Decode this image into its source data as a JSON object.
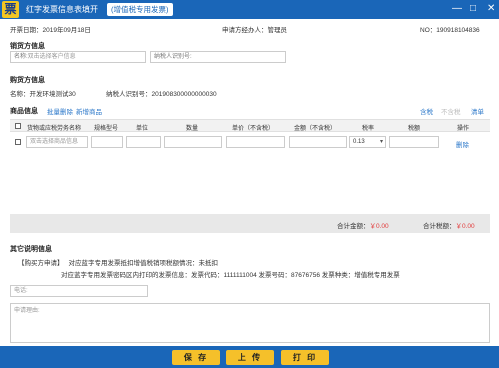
{
  "window": {
    "logo_char": "票",
    "title": "红字发票信息表填开",
    "badge": "(增值税专用发票)",
    "min_glyph": "—",
    "max_glyph": "□",
    "close_glyph": "✕"
  },
  "header": {
    "date_label": "开票日期：",
    "date_value": "2019年09月18日",
    "applicant_label": "申请方经办人：",
    "applicant_value": "管理员",
    "no_label": "NO：",
    "no_value": "190918104836"
  },
  "seller": {
    "title": "销货方信息",
    "name_label": "名称:",
    "name_placeholder": "双击选择客户信息",
    "taxid_label": "纳税人识别号:"
  },
  "buyer": {
    "title": "购货方信息",
    "name_label": "名称：",
    "name_value": "开发环境测试30",
    "taxid_label": "纳税人识别号：",
    "taxid_value": "201908300000000030"
  },
  "goods": {
    "title": "商品信息",
    "batch_delete": "批量删除",
    "add_goods": "新增商品",
    "tax_included": "含税",
    "tax_excluded": "不含税",
    "clear_list": "清单"
  },
  "table": {
    "columns": [
      "货物或应税劳务名称",
      "规格型号",
      "单位",
      "数量",
      "单价（不含税）",
      "金额（不含税）",
      "税率",
      "税额",
      "操作"
    ],
    "row": {
      "name_placeholder": "双击选择商品信息",
      "tax_rate": "0.13",
      "action": "删除"
    }
  },
  "totals": {
    "amount_label": "合计金额：",
    "amount_value": "￥0.00",
    "tax_label": "合计税额：",
    "tax_value": "￥0.00"
  },
  "other": {
    "title": "其它说明信息",
    "tag": "【购买方申请】",
    "line1": "对应蓝字专用发票抵扣增值税销项税额情况：",
    "line1_value": "未抵扣",
    "line2": "对应蓝字专用发票密码区内打印的发票信息：发票代码：1111111004 发票号码：87676756 发票种类：增值税专用发票",
    "phone_placeholder": "电话:",
    "reason_placeholder": "申请理由:"
  },
  "buttons": {
    "save": "保 存",
    "upload": "上 传",
    "print": "打 印"
  },
  "colors": {
    "titlebar": "#1a66b8",
    "button": "#f5c02a",
    "accent_link": "#2a77c9",
    "total_red": "#e23a3a"
  }
}
